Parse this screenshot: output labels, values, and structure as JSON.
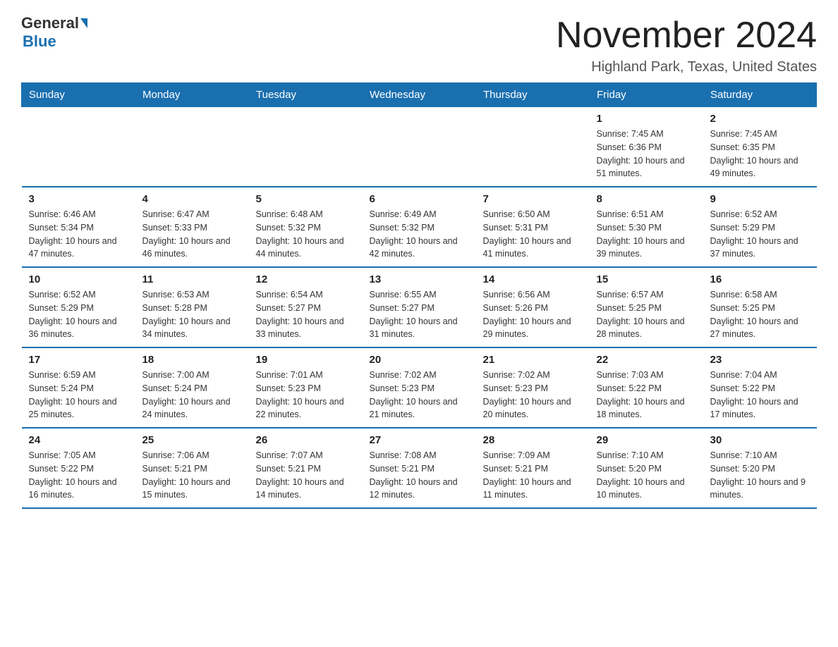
{
  "header": {
    "title": "November 2024",
    "location": "Highland Park, Texas, United States"
  },
  "logo": {
    "general": "General",
    "blue": "Blue"
  },
  "days_of_week": [
    "Sunday",
    "Monday",
    "Tuesday",
    "Wednesday",
    "Thursday",
    "Friday",
    "Saturday"
  ],
  "weeks": [
    [
      {
        "day": "",
        "info": ""
      },
      {
        "day": "",
        "info": ""
      },
      {
        "day": "",
        "info": ""
      },
      {
        "day": "",
        "info": ""
      },
      {
        "day": "",
        "info": ""
      },
      {
        "day": "1",
        "info": "Sunrise: 7:45 AM\nSunset: 6:36 PM\nDaylight: 10 hours and 51 minutes."
      },
      {
        "day": "2",
        "info": "Sunrise: 7:45 AM\nSunset: 6:35 PM\nDaylight: 10 hours and 49 minutes."
      }
    ],
    [
      {
        "day": "3",
        "info": "Sunrise: 6:46 AM\nSunset: 5:34 PM\nDaylight: 10 hours and 47 minutes."
      },
      {
        "day": "4",
        "info": "Sunrise: 6:47 AM\nSunset: 5:33 PM\nDaylight: 10 hours and 46 minutes."
      },
      {
        "day": "5",
        "info": "Sunrise: 6:48 AM\nSunset: 5:32 PM\nDaylight: 10 hours and 44 minutes."
      },
      {
        "day": "6",
        "info": "Sunrise: 6:49 AM\nSunset: 5:32 PM\nDaylight: 10 hours and 42 minutes."
      },
      {
        "day": "7",
        "info": "Sunrise: 6:50 AM\nSunset: 5:31 PM\nDaylight: 10 hours and 41 minutes."
      },
      {
        "day": "8",
        "info": "Sunrise: 6:51 AM\nSunset: 5:30 PM\nDaylight: 10 hours and 39 minutes."
      },
      {
        "day": "9",
        "info": "Sunrise: 6:52 AM\nSunset: 5:29 PM\nDaylight: 10 hours and 37 minutes."
      }
    ],
    [
      {
        "day": "10",
        "info": "Sunrise: 6:52 AM\nSunset: 5:29 PM\nDaylight: 10 hours and 36 minutes."
      },
      {
        "day": "11",
        "info": "Sunrise: 6:53 AM\nSunset: 5:28 PM\nDaylight: 10 hours and 34 minutes."
      },
      {
        "day": "12",
        "info": "Sunrise: 6:54 AM\nSunset: 5:27 PM\nDaylight: 10 hours and 33 minutes."
      },
      {
        "day": "13",
        "info": "Sunrise: 6:55 AM\nSunset: 5:27 PM\nDaylight: 10 hours and 31 minutes."
      },
      {
        "day": "14",
        "info": "Sunrise: 6:56 AM\nSunset: 5:26 PM\nDaylight: 10 hours and 29 minutes."
      },
      {
        "day": "15",
        "info": "Sunrise: 6:57 AM\nSunset: 5:25 PM\nDaylight: 10 hours and 28 minutes."
      },
      {
        "day": "16",
        "info": "Sunrise: 6:58 AM\nSunset: 5:25 PM\nDaylight: 10 hours and 27 minutes."
      }
    ],
    [
      {
        "day": "17",
        "info": "Sunrise: 6:59 AM\nSunset: 5:24 PM\nDaylight: 10 hours and 25 minutes."
      },
      {
        "day": "18",
        "info": "Sunrise: 7:00 AM\nSunset: 5:24 PM\nDaylight: 10 hours and 24 minutes."
      },
      {
        "day": "19",
        "info": "Sunrise: 7:01 AM\nSunset: 5:23 PM\nDaylight: 10 hours and 22 minutes."
      },
      {
        "day": "20",
        "info": "Sunrise: 7:02 AM\nSunset: 5:23 PM\nDaylight: 10 hours and 21 minutes."
      },
      {
        "day": "21",
        "info": "Sunrise: 7:02 AM\nSunset: 5:23 PM\nDaylight: 10 hours and 20 minutes."
      },
      {
        "day": "22",
        "info": "Sunrise: 7:03 AM\nSunset: 5:22 PM\nDaylight: 10 hours and 18 minutes."
      },
      {
        "day": "23",
        "info": "Sunrise: 7:04 AM\nSunset: 5:22 PM\nDaylight: 10 hours and 17 minutes."
      }
    ],
    [
      {
        "day": "24",
        "info": "Sunrise: 7:05 AM\nSunset: 5:22 PM\nDaylight: 10 hours and 16 minutes."
      },
      {
        "day": "25",
        "info": "Sunrise: 7:06 AM\nSunset: 5:21 PM\nDaylight: 10 hours and 15 minutes."
      },
      {
        "day": "26",
        "info": "Sunrise: 7:07 AM\nSunset: 5:21 PM\nDaylight: 10 hours and 14 minutes."
      },
      {
        "day": "27",
        "info": "Sunrise: 7:08 AM\nSunset: 5:21 PM\nDaylight: 10 hours and 12 minutes."
      },
      {
        "day": "28",
        "info": "Sunrise: 7:09 AM\nSunset: 5:21 PM\nDaylight: 10 hours and 11 minutes."
      },
      {
        "day": "29",
        "info": "Sunrise: 7:10 AM\nSunset: 5:20 PM\nDaylight: 10 hours and 10 minutes."
      },
      {
        "day": "30",
        "info": "Sunrise: 7:10 AM\nSunset: 5:20 PM\nDaylight: 10 hours and 9 minutes."
      }
    ]
  ]
}
